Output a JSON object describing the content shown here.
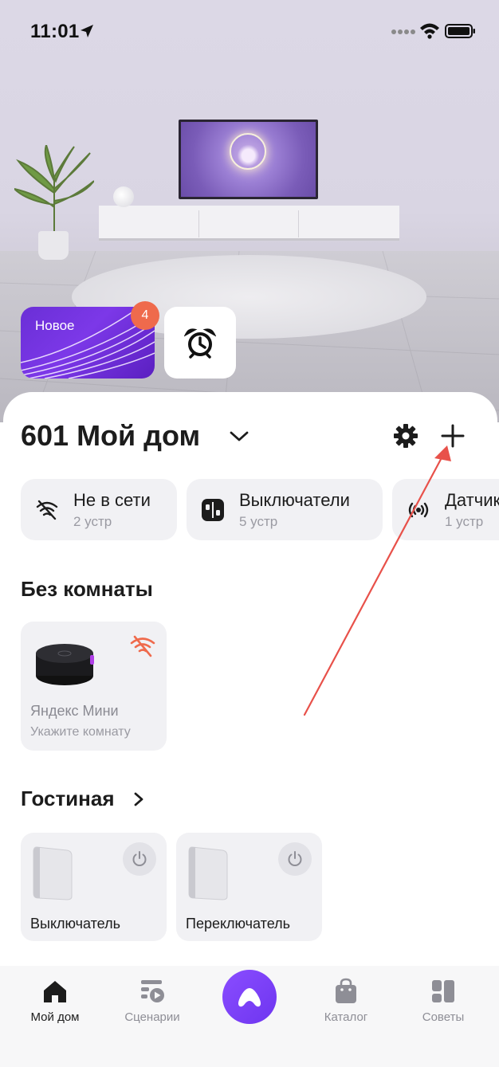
{
  "status_bar": {
    "time": "11:01"
  },
  "hero": {
    "new_tile": {
      "label": "Новое",
      "badge_count": "4"
    },
    "alarm_tile": {
      "icon": "alarm-clock-icon"
    }
  },
  "home": {
    "title": "601 Мой дом",
    "settings_icon": "gear-icon",
    "add_icon": "plus-icon"
  },
  "chips": [
    {
      "title": "Не в сети",
      "sub": "2 устр",
      "icon": "wifi-off-icon"
    },
    {
      "title": "Выключатели",
      "sub": "5 устр",
      "icon": "switch-icon"
    },
    {
      "title": "Датчики",
      "sub": "1 устр",
      "icon": "sensor-icon"
    }
  ],
  "rooms": [
    {
      "title": "Без комнаты",
      "devices": [
        {
          "name": "Яндекс Мини",
          "sub": "Укажите комнату",
          "status": "offline"
        }
      ]
    },
    {
      "title": "Гостиная",
      "devices": [
        {
          "name": "Выключатель"
        },
        {
          "name": "Переключатель"
        }
      ]
    }
  ],
  "tabbar": {
    "items": [
      {
        "label": "Мой дом",
        "icon": "home-icon",
        "active": true
      },
      {
        "label": "Сценарии",
        "icon": "scenarios-icon",
        "active": false
      },
      {
        "label": "Каталог",
        "icon": "shopping-bag-icon",
        "active": false
      },
      {
        "label": "Советы",
        "icon": "tips-icon",
        "active": false
      }
    ],
    "center_icon": "alice-icon"
  },
  "colors": {
    "accent": "#7a3ff0",
    "badge": "#ef6a4c",
    "annotation": "#e8514a",
    "chip_bg": "#f1f1f4"
  }
}
